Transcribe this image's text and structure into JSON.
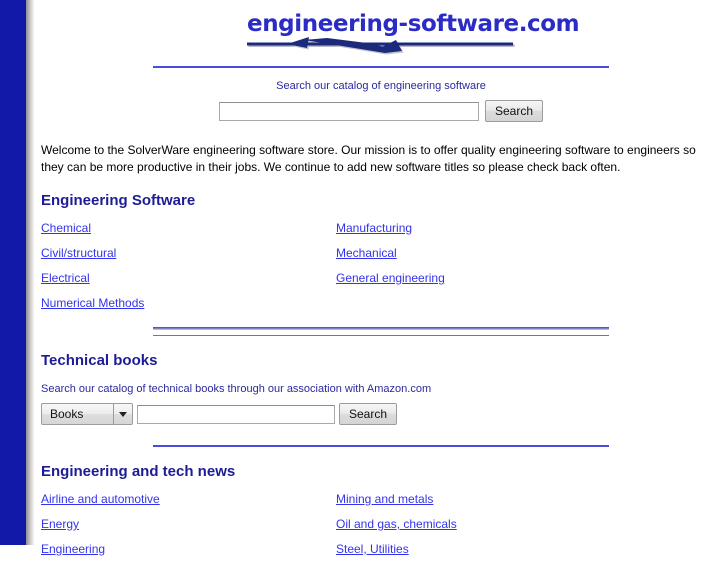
{
  "site": {
    "logo_text": "engineering-software.com",
    "logo_icon": "swoosh-arrow-graphic"
  },
  "catalog_search": {
    "caption": "Search our catalog of engineering software",
    "input_value": "",
    "input_placeholder": "",
    "button_label": "Search"
  },
  "intro": {
    "paragraph": "Welcome to the SolverWare engineering software store. Our mission is to offer quality engineering software to engineers so they can be more productive in their jobs. We continue to add new software titles so please check back often."
  },
  "software_section": {
    "title": "Engineering Software",
    "left_links": [
      {
        "label": "Chemical"
      },
      {
        "label": "Civil/structural"
      },
      {
        "label": "Electrical"
      },
      {
        "label": "Numerical Methods"
      }
    ],
    "right_links": [
      {
        "label": "Manufacturing"
      },
      {
        "label": "Mechanical"
      },
      {
        "label": "General engineering"
      }
    ]
  },
  "books_section": {
    "title": "Technical books",
    "caption": "Search our catalog of technical books through our association with Amazon.com",
    "category_selected": "Books",
    "category_icon": "chevron-down-icon",
    "input_value": "",
    "input_placeholder": "",
    "button_label": "Search"
  },
  "news_section": {
    "title": "Engineering and tech news",
    "left_links": [
      {
        "label": "Airline and automotive"
      },
      {
        "label": "Energy"
      },
      {
        "label": "Engineering"
      }
    ],
    "right_links": [
      {
        "label": "Mining and metals"
      },
      {
        "label": "Oil and gas, chemicals"
      },
      {
        "label": "Steel, Utilities"
      }
    ]
  },
  "colors": {
    "sidebar_blue": "#1218a8",
    "logo_blue": "#2b2bc6",
    "heading_navy": "#1c1c96",
    "link_blue": "#3333ee",
    "rule_blue": "#4b4be0"
  }
}
